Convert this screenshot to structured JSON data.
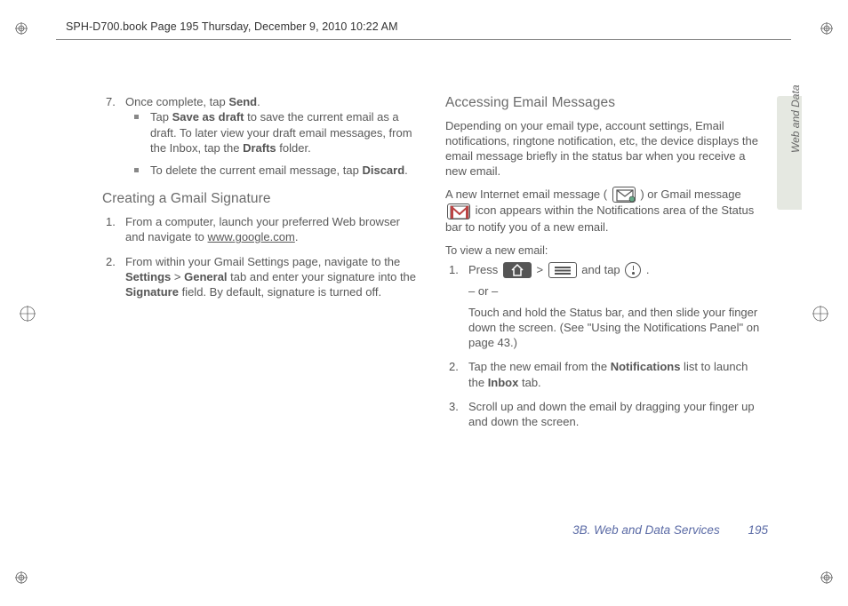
{
  "header": "SPH-D700.book  Page 195  Thursday, December 9, 2010  10:22 AM",
  "side_tab": "Web and Data",
  "footer": {
    "section": "3B. Web and Data Services",
    "page": "195"
  },
  "left": {
    "step7": {
      "num": "7.",
      "text_a": "Once complete, tap ",
      "send": "Send",
      "dot": ".",
      "b1_a": "Tap ",
      "b1_bold": "Save as draft",
      "b1_b": " to save the current email as a draft. To later view your draft email messages, from the Inbox, tap the ",
      "b1_bold2": "Drafts",
      "b1_c": " folder.",
      "b2_a": "To delete the current email message, tap ",
      "b2_bold": "Discard",
      "b2_b": "."
    },
    "h2": "Creating a Gmail Signature",
    "s1": {
      "num": "1.",
      "a": "From a computer, launch your preferred Web browser and navigate to ",
      "link": "www.google.com",
      "b": "."
    },
    "s2": {
      "num": "2.",
      "a": "From within your Gmail Settings page, navigate to the ",
      "b1": "Settings",
      "gt": " > ",
      "b2": "General",
      "b": " tab and enter your signature into the ",
      "b3": "Signature",
      "c": " field. By default, signature is turned off."
    }
  },
  "right": {
    "h2": "Accessing Email Messages",
    "p1": "Depending on your email type, account settings, Email notifications, ringtone notification, etc, the device displays the email message briefly in the status bar when you receive a new email.",
    "p2_a": "A new Internet email message ( ",
    "p2_b": " ) or Gmail message ",
    "p2_c": " icon appears within the Notifications area of the Status bar to notify you of a new email.",
    "h3": "To view a new email:",
    "s1": {
      "num": "1.",
      "a": "Press ",
      "gt": " > ",
      "b": " and tap ",
      "dot": " .",
      "or": "– or –",
      "c": "Touch and hold the Status bar, and then slide your finger down the screen. (See \"Using the Notifications Panel\" on page 43.)"
    },
    "s2": {
      "num": "2.",
      "a": "Tap the new email from the ",
      "b1": "Notifications",
      "b": " list to launch the ",
      "b2": "Inbox",
      "c": " tab."
    },
    "s3": {
      "num": "3.",
      "a": "Scroll up and down the email by dragging your finger up and down the screen."
    }
  }
}
